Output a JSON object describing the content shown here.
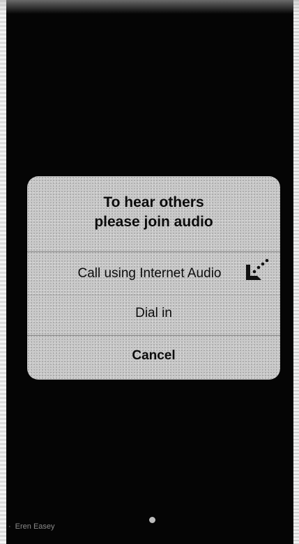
{
  "dialog": {
    "title_line1": "To hear others",
    "title_line2": "please join audio",
    "options": {
      "internet_audio": "Call using Internet Audio",
      "dial_in": "Dial in",
      "cancel": "Cancel"
    }
  },
  "participant": {
    "name": "Eren Easey"
  },
  "icons": {
    "internet_audio_icon": "pointer-arrow-icon",
    "home_indicator_icon": "dot-icon"
  },
  "colors": {
    "background": "#050505",
    "dialog_background": "#c9c9c9",
    "text": "#0c0c0c"
  }
}
